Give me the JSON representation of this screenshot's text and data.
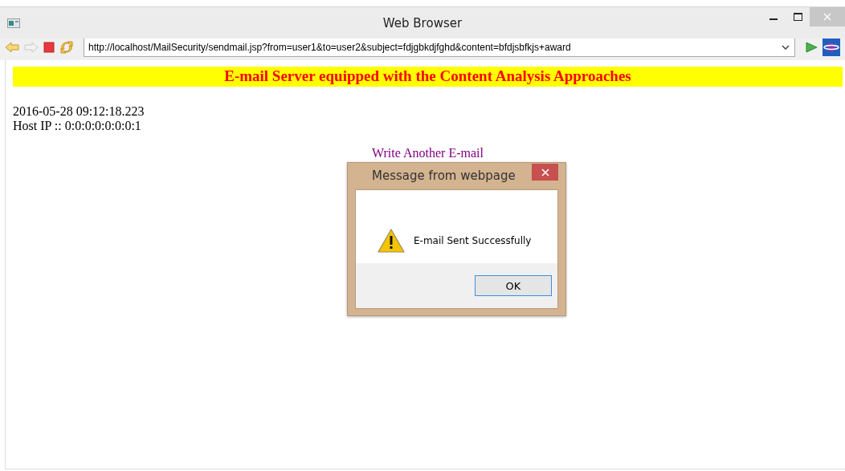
{
  "window": {
    "title": "Web Browser"
  },
  "address_bar": {
    "value": "http://localhost/MailSecurity/sendmail.jsp?from=user1&to=user2&subject=fdjgbkdjfghd&content=bfdjsbfkjs+award"
  },
  "page": {
    "banner": "E-mail Server equipped with the Content Analysis Approaches",
    "timestamp": "2016-05-28 09:12:18.223",
    "host_ip": "Host IP :: 0:0:0:0:0:0:0:1",
    "link": "Write Another E-mail"
  },
  "dialog": {
    "title": "Message from webpage",
    "message": "E-mail Sent Successfully",
    "button": "OK"
  }
}
